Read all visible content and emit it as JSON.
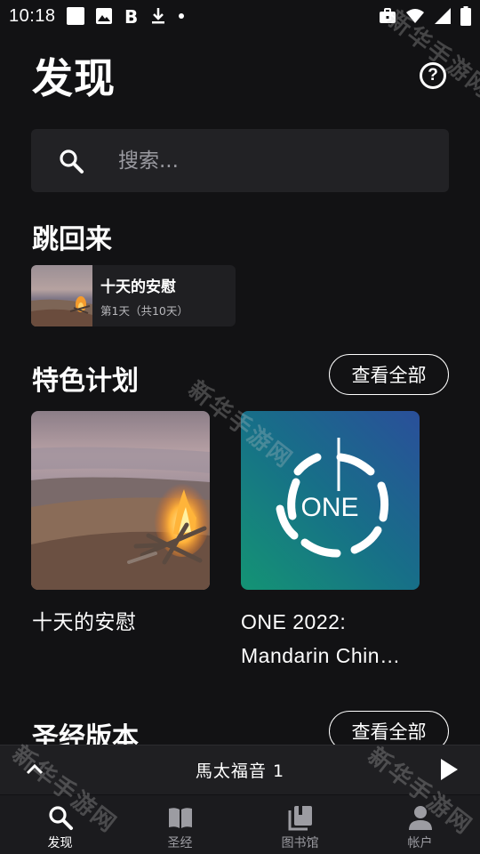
{
  "status_bar": {
    "time": "10:18",
    "notification_icons": [
      "square-icon",
      "image-icon",
      "bold-b-icon",
      "download-icon",
      "dot-icon"
    ],
    "system_icons": [
      "briefcase-icon",
      "wifi-icon",
      "signal-icon",
      "battery-icon"
    ]
  },
  "header": {
    "title": "发现",
    "help_label": "?"
  },
  "search": {
    "placeholder": "搜索..."
  },
  "jump_back": {
    "section_title": "跳回来",
    "card": {
      "title": "十天的安慰",
      "subtitle": "第1天（共10天）"
    }
  },
  "featured": {
    "section_title": "特色计划",
    "see_all": "查看全部",
    "plans": [
      {
        "title": "十天的安慰"
      },
      {
        "title": "ONE 2022: Mandarin Chin…",
        "image_text": "ONE"
      }
    ]
  },
  "versions": {
    "section_title": "圣经版本",
    "see_all": "查看全部"
  },
  "audio": {
    "title": "馬太福音 1"
  },
  "nav": {
    "items": [
      {
        "label": "发现",
        "icon": "search-icon"
      },
      {
        "label": "圣经",
        "icon": "bible-icon"
      },
      {
        "label": "图书馆",
        "icon": "library-icon"
      },
      {
        "label": "帐户",
        "icon": "account-icon"
      }
    ],
    "active_index": 0
  },
  "watermark": {
    "text": "新华手游网"
  },
  "colors": {
    "background": "#121214",
    "card": "#222225",
    "text": "#ffffff",
    "muted": "#9c9ca2"
  }
}
